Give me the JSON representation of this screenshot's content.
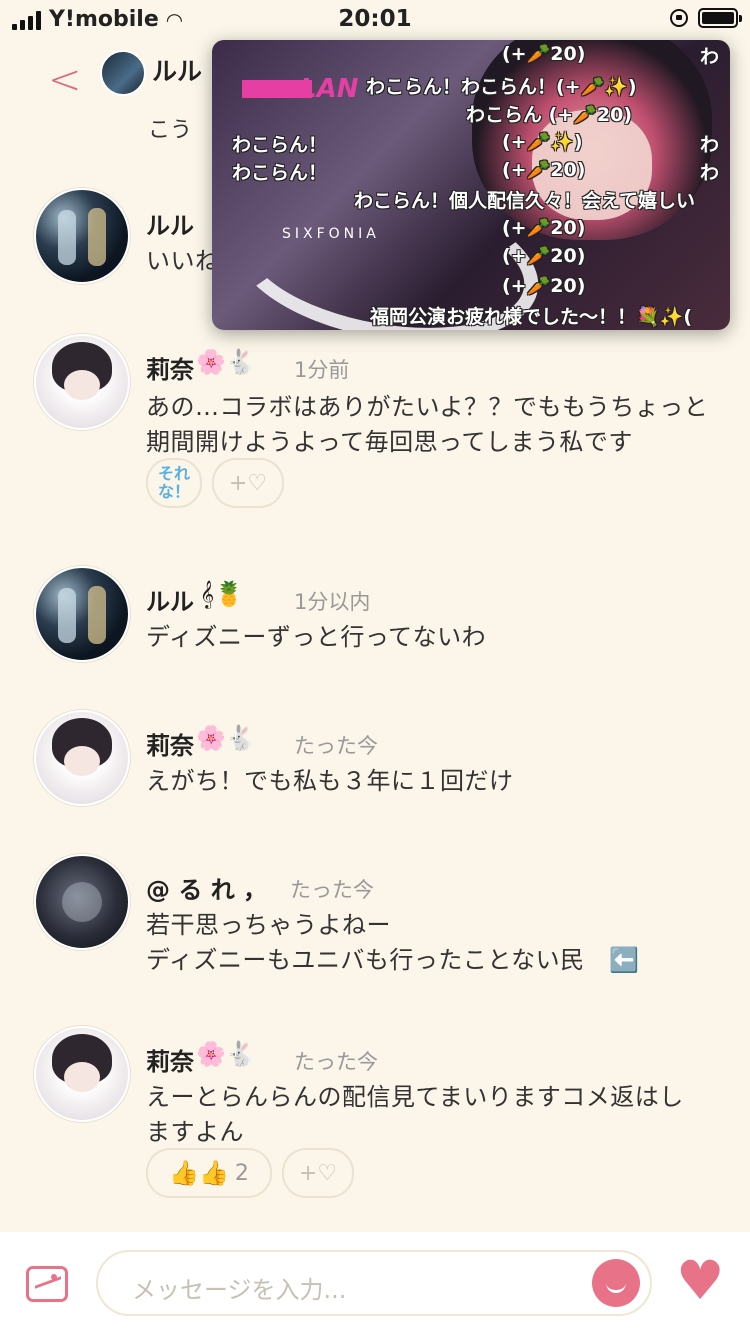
{
  "status": {
    "carrier": "Y!mobile",
    "time": "20:01"
  },
  "header": {
    "title": "ルル",
    "back_icon": "chevron-left-icon"
  },
  "clipped_top_text": "こう",
  "messages": [
    {
      "user": "ルル",
      "emoji": "",
      "time": "",
      "body": "いいね",
      "avatar": "lulu"
    },
    {
      "user": "莉奈",
      "emoji": "🌸🐇",
      "time": "1分前",
      "body": "あの…コラボはありがたいよ？？でももうちょっと期間開けようよって毎回思ってしまう私です",
      "avatar": "rina",
      "reactions": [
        {
          "label": "それな！",
          "count": ""
        }
      ]
    },
    {
      "user": "ルル",
      "emoji": "𝄞🍍",
      "time": "1分以内",
      "body": "ディズニーずっと行ってないわ",
      "avatar": "lulu"
    },
    {
      "user": "莉奈",
      "emoji": "🌸🐇",
      "time": "たった今",
      "body": "えがち！でも私も３年に１回だけ",
      "avatar": "rina"
    },
    {
      "user": "@ る れ ，",
      "emoji": "",
      "time": "たった今",
      "body": "若干思っちゃうよねー\nディズニーもユニバも行ったことない民　⬅️",
      "avatar": "rere"
    },
    {
      "user": "莉奈",
      "emoji": "🌸🐇",
      "time": "たった今",
      "body": "えーとらんらんの配信見てまいりますコメ返はしますよん",
      "avatar": "rina",
      "reactions": [
        {
          "label": "👍👍",
          "count": "2"
        }
      ]
    }
  ],
  "reaction_add_label": "+♡",
  "video": {
    "logo_lan": "LAN",
    "logo_sub": "SIXFONIA",
    "comments": [
      "(+🥕20)",
      "わこらん！わこらん！(+🥕✨)",
      "わこらん (+🥕20)",
      "わこらん！",
      "(+🥕✨)",
      "わこらん！",
      "(+🥕20)",
      "わこらん！個人配信久々！会えて嬉しい",
      "(+🥕20)",
      "(+🥕20)",
      "(+🥕20)",
      "福岡公演お疲れ様でした〜！！💐✨(",
      "わ",
      "わ",
      "わ"
    ]
  },
  "composer": {
    "placeholder": "メッセージを入力..."
  },
  "icons": {
    "image": "image-icon",
    "emoji": "smile-icon",
    "like": "heart-icon"
  },
  "colors": {
    "accent": "#e87388",
    "background": "#fbf6e9"
  }
}
